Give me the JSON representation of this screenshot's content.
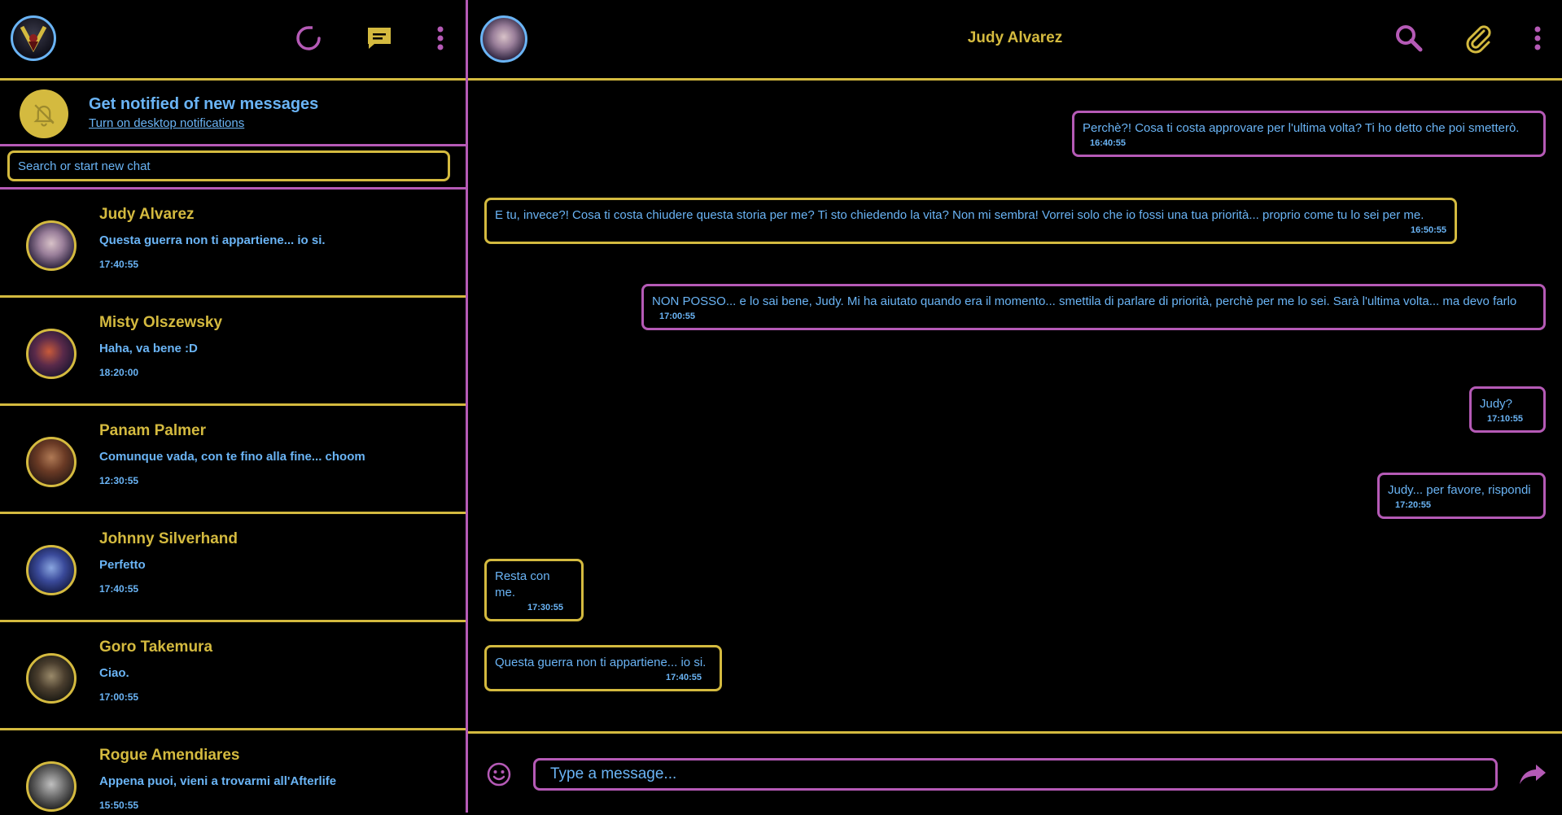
{
  "colors": {
    "accent_yellow": "#d4ba3f",
    "accent_pink": "#b55ab6",
    "text_blue": "#6ab4f5",
    "background": "#000000"
  },
  "sidebar": {
    "header_icons": [
      "refresh-icon",
      "chat-icon",
      "more-vertical-icon"
    ],
    "notification": {
      "title": "Get notified of new messages",
      "link": "Turn on desktop notifications",
      "icon": "bell-off-icon"
    },
    "search": {
      "placeholder": "Search or start new chat"
    },
    "chats": [
      {
        "name": "Judy Alvarez",
        "preview": "Questa guerra non ti appartiene... io si.",
        "time": "17:40:55"
      },
      {
        "name": "Misty Olszewsky",
        "preview": "Haha, va bene :D",
        "time": "18:20:00"
      },
      {
        "name": "Panam Palmer",
        "preview": "Comunque vada, con te fino alla fine... choom",
        "time": "12:30:55"
      },
      {
        "name": "Johnny Silverhand",
        "preview": "Perfetto",
        "time": "17:40:55"
      },
      {
        "name": "Goro Takemura",
        "preview": "Ciao.",
        "time": "17:00:55"
      },
      {
        "name": "Rogue Amendiares",
        "preview": "Appena puoi, vieni a trovarmi all'Afterlife",
        "time": "15:50:55"
      }
    ]
  },
  "conversation": {
    "title": "Judy Alvarez",
    "header_icons": [
      "search-icon",
      "paperclip-icon",
      "more-vertical-icon"
    ],
    "messages": [
      {
        "direction": "out",
        "text": "Perchè?! Cosa ti costa approvare per l'ultima volta? Ti ho detto che poi smetterò.",
        "time": "16:40:55"
      },
      {
        "direction": "in",
        "text": "E tu, invece?! Cosa ti costa chiudere questa storia per me? Ti sto chiedendo la vita? Non mi sembra! Vorrei solo che io fossi una tua priorità... proprio come tu lo sei per me.",
        "time": "16:50:55"
      },
      {
        "direction": "out",
        "text": "NON POSSO... e lo sai bene, Judy. Mi ha aiutato quando era il momento... smettila di parlare di priorità, perchè per me lo sei. Sarà l'ultima volta... ma devo farlo",
        "time": "17:00:55"
      },
      {
        "direction": "out",
        "text": "Judy?",
        "time": "17:10:55"
      },
      {
        "direction": "out",
        "text": "Judy... per favore, rispondi",
        "time": "17:20:55"
      },
      {
        "direction": "in",
        "text": "Resta con me.",
        "time": "17:30:55"
      },
      {
        "direction": "in",
        "text": "Questa guerra non ti appartiene... io si.",
        "time": "17:40:55"
      }
    ],
    "composer": {
      "placeholder": "Type a message...",
      "emoji_icon": "smiley-icon",
      "send_icon": "send-icon"
    }
  }
}
